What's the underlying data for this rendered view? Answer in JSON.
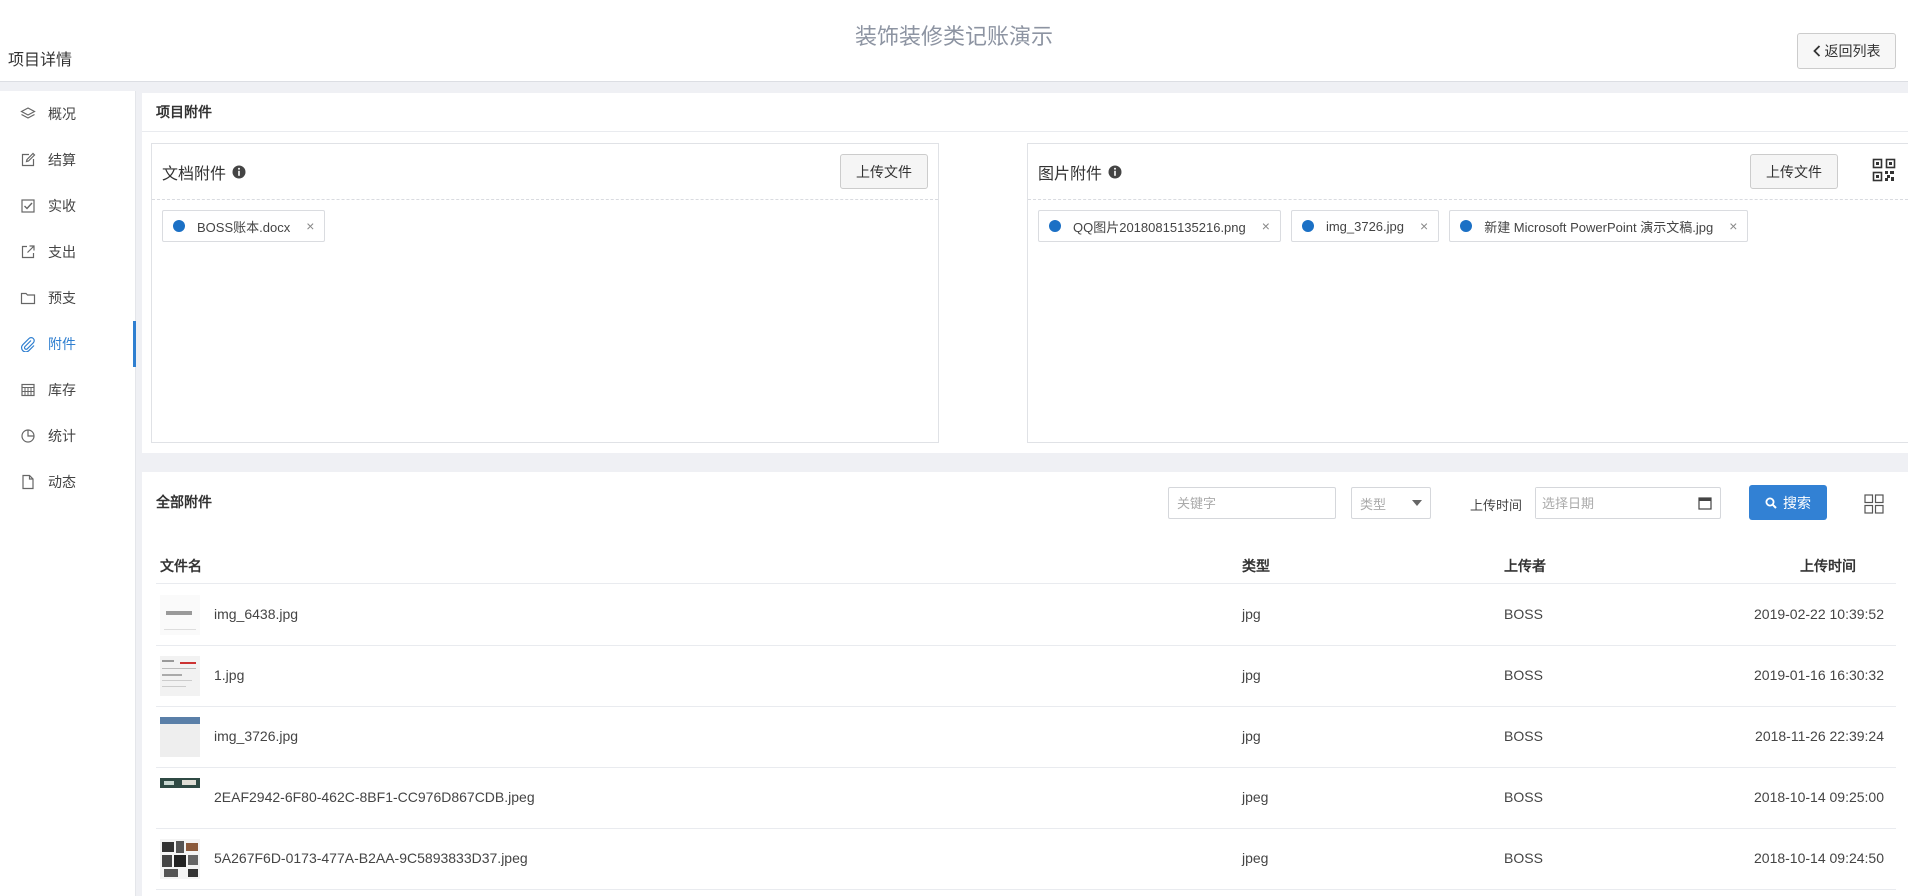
{
  "header": {
    "page_title": "项目详情",
    "app_title": "装饰装修类记账演示",
    "back_label": "返回列表"
  },
  "sidebar": {
    "items": [
      {
        "label": "概况",
        "icon": "layers-icon"
      },
      {
        "label": "结算",
        "icon": "edit-icon"
      },
      {
        "label": "实收",
        "icon": "checkbox-icon"
      },
      {
        "label": "支出",
        "icon": "external-link-icon"
      },
      {
        "label": "预支",
        "icon": "folder-icon"
      },
      {
        "label": "附件",
        "icon": "paperclip-icon",
        "active": true
      },
      {
        "label": "库存",
        "icon": "calendar-grid-icon"
      },
      {
        "label": "统计",
        "icon": "pie-chart-icon"
      },
      {
        "label": "动态",
        "icon": "file-icon"
      }
    ]
  },
  "attachments": {
    "title": "项目附件",
    "documents": {
      "title": "文档附件",
      "upload_label": "上传文件",
      "files": [
        "BOSS账本.docx"
      ]
    },
    "images": {
      "title": "图片附件",
      "upload_label": "上传文件",
      "files": [
        "QQ图片20180815135216.png",
        "img_3726.jpg",
        "新建 Microsoft PowerPoint 演示文稿.jpg"
      ]
    }
  },
  "all_files": {
    "title": "全部附件",
    "filters": {
      "keyword_placeholder": "关键字",
      "type_placeholder": "类型",
      "time_label": "上传时间",
      "date_placeholder": "选择日期",
      "search_label": "搜索"
    },
    "columns": {
      "name": "文件名",
      "type": "类型",
      "uploader": "上传者",
      "time": "上传时间"
    },
    "rows": [
      {
        "name": "img_6438.jpg",
        "type": "jpg",
        "uploader": "BOSS",
        "time": "2019-02-22 10:39:52"
      },
      {
        "name": "1.jpg",
        "type": "jpg",
        "uploader": "BOSS",
        "time": "2019-01-16 16:30:32"
      },
      {
        "name": "img_3726.jpg",
        "type": "jpg",
        "uploader": "BOSS",
        "time": "2018-11-26 22:39:24"
      },
      {
        "name": "2EAF2942-6F80-462C-8BF1-CC976D867CDB.jpeg",
        "type": "jpeg",
        "uploader": "BOSS",
        "time": "2018-10-14 09:25:00"
      },
      {
        "name": "5A267F6D-0173-477A-B2AA-9C5893833D37.jpeg",
        "type": "jpeg",
        "uploader": "BOSS",
        "time": "2018-10-14 09:24:50"
      }
    ]
  },
  "colors": {
    "accent": "#3281d4",
    "chip_dot": "#1b70c5",
    "title_gray": "#8d94a2"
  }
}
